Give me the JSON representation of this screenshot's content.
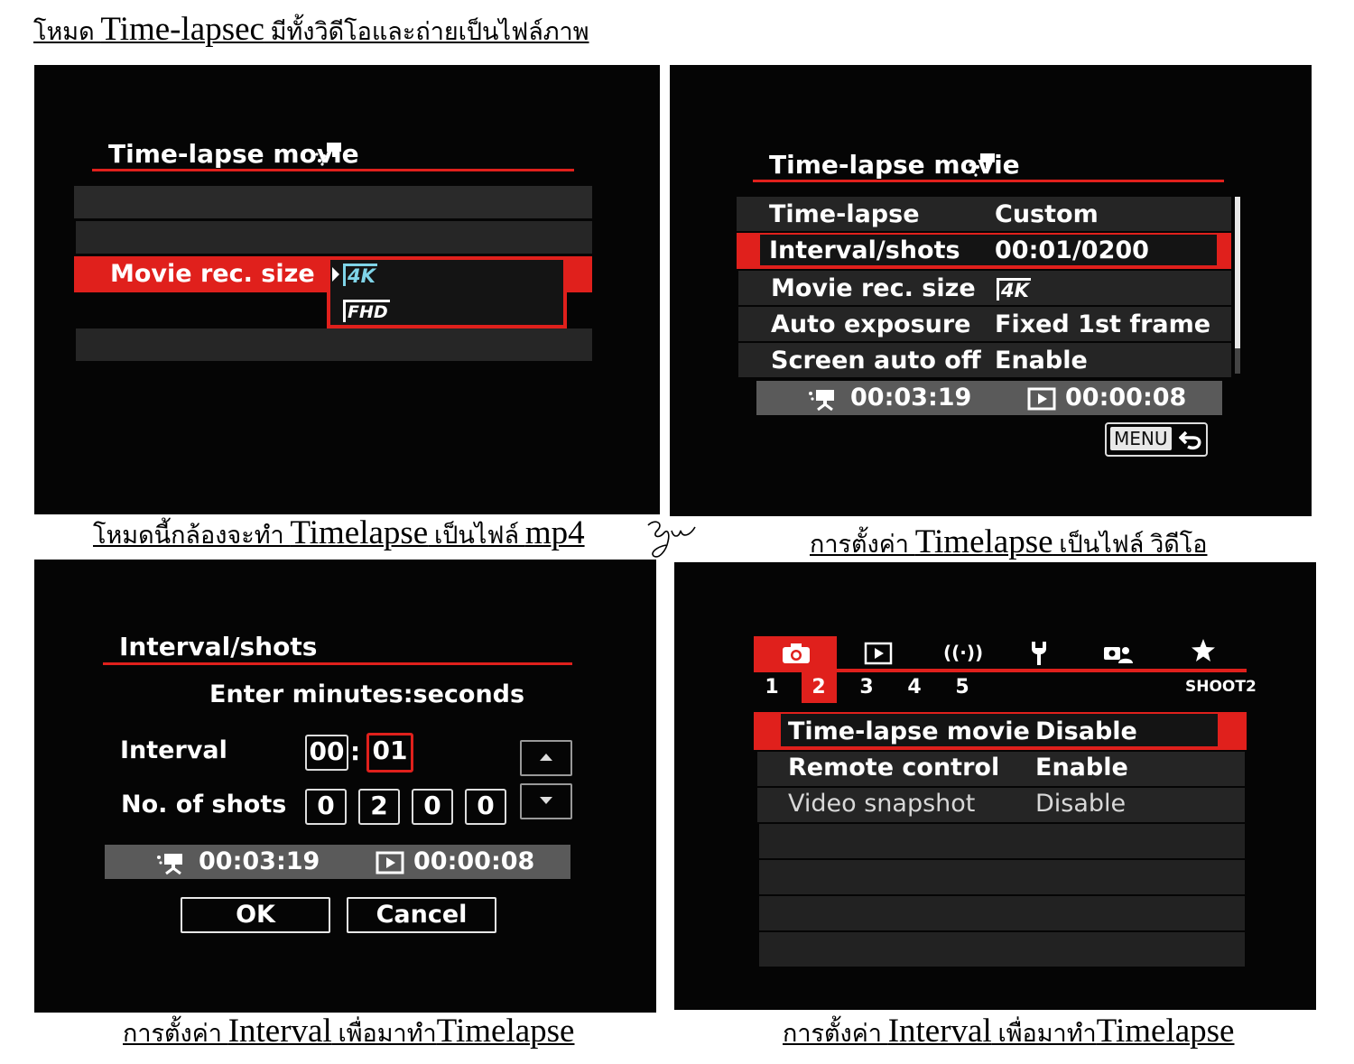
{
  "header": {
    "prefix": "โหมด ",
    "title_en": "Time-lapsec",
    "suffix": " มีทั้งวิดีโอและถ่ายเป็นไฟล์ภาพ"
  },
  "signature": "รุ่ง",
  "panel1": {
    "title": "Time-lapse movie",
    "item_label": "Movie rec. size",
    "option_4k": "4K",
    "option_fhd": "FHD",
    "caption_prefix": "โหมดนี้กล้องจะทำ ",
    "caption_en": "Timelapse",
    "caption_suffix": " เป็นไฟล์ ",
    "caption_ext": "mp4"
  },
  "panel2": {
    "title": "Time-lapse movie",
    "rows": [
      {
        "label": "Time-lapse",
        "value": "Custom"
      },
      {
        "label": "Interval/shots",
        "value": "00:01/0200"
      },
      {
        "label": "Movie rec. size",
        "value": "4K"
      },
      {
        "label": "Auto exposure",
        "value": "Fixed 1st frame"
      },
      {
        "label": "Screen auto off",
        "value": "Enable"
      }
    ],
    "rec_time": "00:03:19",
    "play_time": "00:00:08",
    "menu_label": "MENU",
    "caption_prefix": "การตั้งค่า ",
    "caption_en": "Timelapse",
    "caption_suffix": " เป็นไฟล์ วิดีโอ"
  },
  "panel3": {
    "title": "Interval/shots",
    "instruction": "Enter minutes:seconds",
    "interval_label": "Interval",
    "interval_min": "00",
    "interval_sep": ":",
    "interval_sec": "01",
    "shots_label": "No. of shots",
    "shots_digits": [
      "0",
      "2",
      "0",
      "0"
    ],
    "rec_time": "00:03:19",
    "play_time": "00:00:08",
    "ok_label": "OK",
    "cancel_label": "Cancel",
    "caption_prefix": "การตั้งค่า ",
    "caption_en": "Interval",
    "caption_suffix": " เพื่อมาทำ",
    "caption_en2": "Timelapse"
  },
  "panel4": {
    "tab_numbers": [
      "1",
      "2",
      "3",
      "4",
      "5"
    ],
    "shoot_label": "SHOOT2",
    "rows": [
      {
        "label": "Time-lapse movie",
        "value": "Disable"
      },
      {
        "label": "Remote control",
        "value": "Enable"
      },
      {
        "label": "Video snapshot",
        "value": "Disable"
      }
    ],
    "caption_prefix": "การตั้งค่า ",
    "caption_en": "Interval",
    "caption_suffix": " เพื่อมาทำ",
    "caption_en2": "Timelapse"
  },
  "colors": {
    "accent_red": "#e0201c",
    "screen_bg": "#050505",
    "row_bg": "#252525",
    "status_bar": "#5a5a5a"
  }
}
